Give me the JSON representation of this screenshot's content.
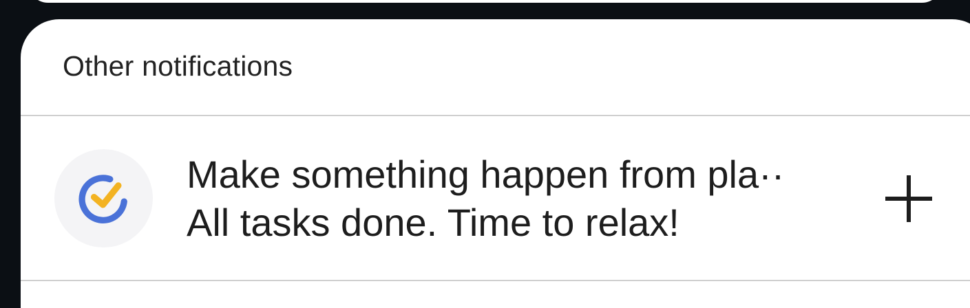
{
  "section": {
    "title": "Other notifications"
  },
  "notification": {
    "app_icon": "ticktick-check-icon",
    "title": "Make something happen from pla··",
    "body": "All tasks done. Time to relax!",
    "action_icon": "plus-icon"
  },
  "colors": {
    "background": "#0b0f14",
    "panel": "#ffffff",
    "divider": "#cfcfcf",
    "icon_blue": "#4a72d8",
    "icon_yellow": "#f3b322",
    "text": "#1d1d1d"
  }
}
